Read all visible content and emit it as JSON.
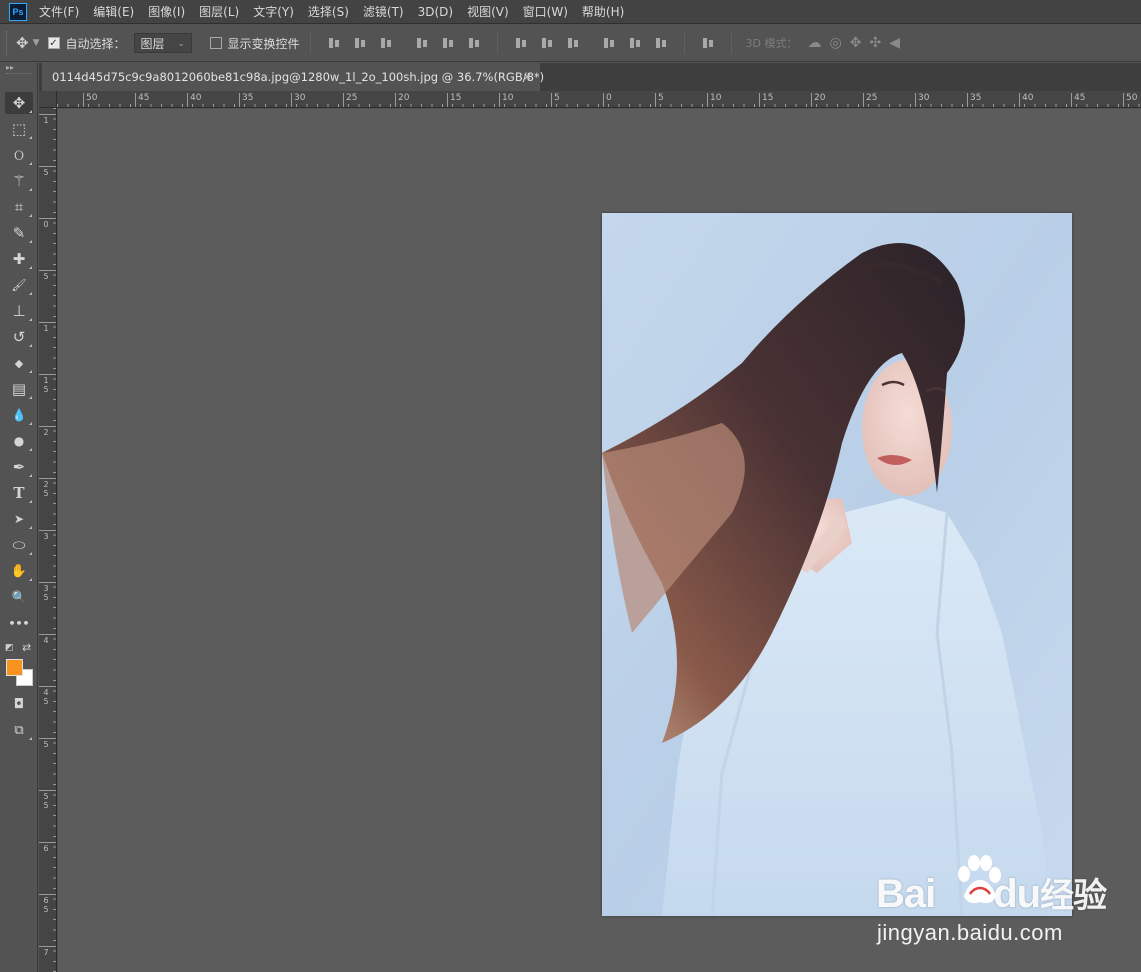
{
  "app": {
    "logo_text": "Ps"
  },
  "menu": [
    "文件(F)",
    "编辑(E)",
    "图像(I)",
    "图层(L)",
    "文字(Y)",
    "选择(S)",
    "滤镜(T)",
    "3D(D)",
    "视图(V)",
    "窗口(W)",
    "帮助(H)"
  ],
  "options": {
    "auto_select_label": "自动选择：",
    "auto_select_checked": true,
    "auto_select_target": "图层",
    "show_transform_label": "显示变换控件",
    "show_transform_checked": false,
    "mode_3d_label": "3D 模式："
  },
  "document": {
    "tab_title": "0114d45d75c9c9a8012060be81c98a.jpg@1280w_1l_2o_100sh.jpg @ 36.7%(RGB/8*)",
    "close_glyph": "×"
  },
  "ruler": {
    "top_labels": [
      "50",
      "45",
      "40",
      "35",
      "30",
      "25",
      "20",
      "15",
      "10",
      "5",
      "0",
      "5",
      "10",
      "15",
      "20",
      "25",
      "30",
      "35",
      "40",
      "45",
      "50"
    ],
    "left_labels": [
      "1",
      "5",
      "0",
      "5",
      "1",
      "1 5",
      "2",
      "2 5",
      "3",
      "3 5",
      "4",
      "4 5",
      "5",
      "5 5",
      "6",
      "6 5",
      "7"
    ]
  },
  "colors": {
    "foreground": "#f7931e",
    "background": "#ffffff"
  },
  "tools": [
    {
      "name": "move-tool",
      "glyph": "✥"
    },
    {
      "name": "marquee-tool",
      "glyph": "⬚"
    },
    {
      "name": "lasso-tool",
      "glyph": "ଠ"
    },
    {
      "name": "magic-wand-tool",
      "glyph": "⚚"
    },
    {
      "name": "crop-tool",
      "glyph": "⌗"
    },
    {
      "name": "eyedropper-tool",
      "glyph": "✎"
    },
    {
      "name": "healing-brush-tool",
      "glyph": "✚"
    },
    {
      "name": "brush-tool",
      "glyph": "🖌"
    },
    {
      "name": "clone-stamp-tool",
      "glyph": "⊥"
    },
    {
      "name": "history-brush-tool",
      "glyph": "↺"
    },
    {
      "name": "eraser-tool",
      "glyph": "◆"
    },
    {
      "name": "gradient-tool",
      "glyph": "▤"
    },
    {
      "name": "blur-tool",
      "glyph": "💧"
    },
    {
      "name": "dodge-tool",
      "glyph": "●"
    },
    {
      "name": "pen-tool",
      "glyph": "✒"
    },
    {
      "name": "type-tool",
      "glyph": "T"
    },
    {
      "name": "path-selection-tool",
      "glyph": "➤"
    },
    {
      "name": "ellipse-tool",
      "glyph": "⬭"
    },
    {
      "name": "hand-tool",
      "glyph": "✋"
    },
    {
      "name": "zoom-tool",
      "glyph": "🔍"
    },
    {
      "name": "more-tools",
      "glyph": "•••"
    }
  ],
  "watermark": {
    "brand": "Bai",
    "brand2": "du",
    "suffix": "经验",
    "url": "jingyan.baidu.com"
  }
}
